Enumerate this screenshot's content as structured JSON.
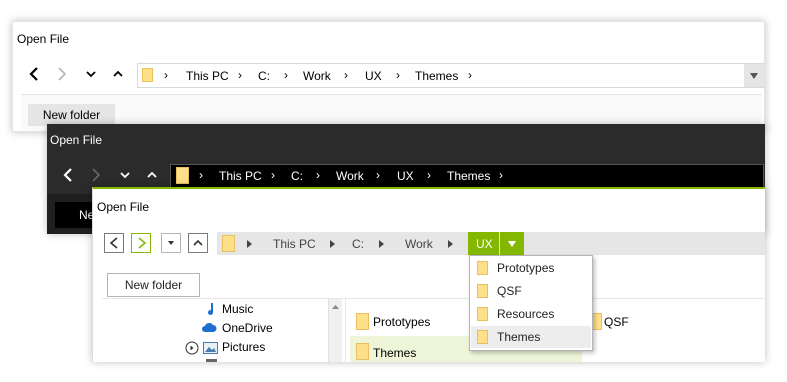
{
  "window1": {
    "title": "Open File",
    "crumbs": [
      "This PC",
      "C:",
      "Work",
      "UX",
      "Themes"
    ],
    "new_folder": "New folder"
  },
  "window2": {
    "title": "Open File",
    "crumbs": [
      "This PC",
      "C:",
      "Work",
      "UX",
      "Themes"
    ],
    "new_folder_partial": "Ne"
  },
  "window3": {
    "title": "Open File",
    "crumbs": [
      "This PC",
      "C:",
      "Work"
    ],
    "active_crumb": "UX",
    "new_folder": "New folder",
    "tree": {
      "music": "Music",
      "onedrive": "OneDrive",
      "pictures": "Pictures"
    },
    "files": {
      "prototypes": "Prototypes",
      "themes": "Themes",
      "qsf": "QSF"
    },
    "dropdown": [
      "Prototypes",
      "QSF",
      "Resources",
      "Themes"
    ],
    "dropdown_selected": "Themes"
  },
  "colors": {
    "accent_green": "#84b800",
    "dark_bg": "#2b2b2b",
    "folder_yellow": "#ffe08a",
    "selected_file_bg": "#eef5d8"
  },
  "icons": {
    "back": "chevron-left-icon",
    "forward": "chevron-right-icon",
    "recent": "chevron-down-icon",
    "up": "chevron-up-icon",
    "folder": "folder-icon",
    "music": "music-note-icon",
    "onedrive": "cloud-icon",
    "pictures": "pictures-icon",
    "expand": "expand-circle-icon"
  }
}
